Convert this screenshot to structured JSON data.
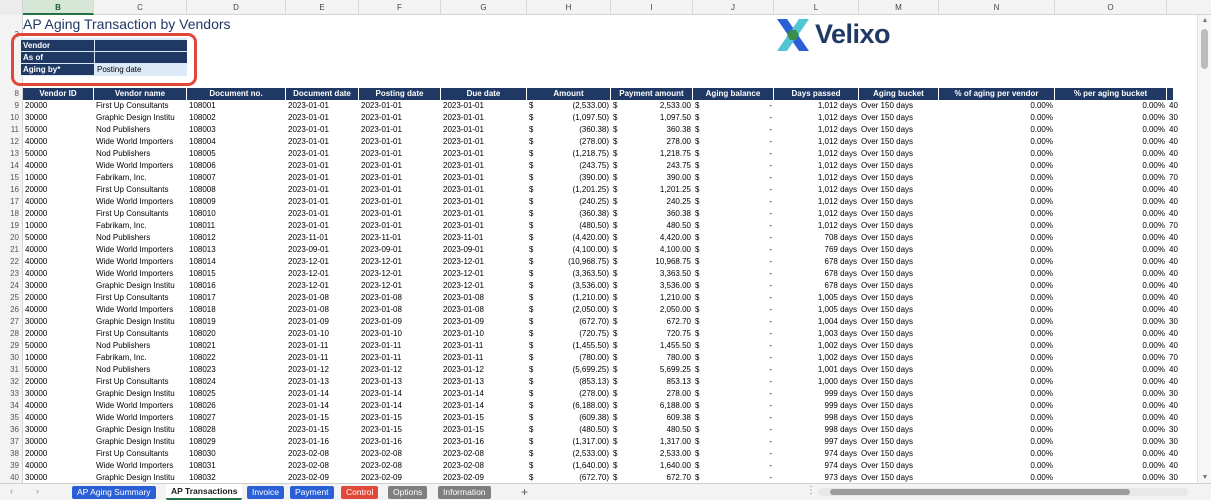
{
  "sheet": {
    "title": "AP Aging Transaction by Vendors",
    "column_letters": [
      "B",
      "C",
      "D",
      "E",
      "F",
      "G",
      "H",
      "I",
      "J",
      "L",
      "M",
      "N",
      "O"
    ],
    "selected_column": "B"
  },
  "params": {
    "vendor_label": "Vendor",
    "vendor_value": "",
    "asof_label": "As of",
    "asof_value": "",
    "agingby_label": "Aging by*",
    "agingby_value": "Posting date"
  },
  "logo": {
    "text": "Velixo",
    "icon": "velixo-x-logo-icon",
    "colors": [
      "#2b5fd6",
      "#3fbfd0",
      "#3b8d4a"
    ]
  },
  "table": {
    "headers": [
      "Vendor ID",
      "Vendor name",
      "Document no.",
      "Document date",
      "Posting date",
      "Due date",
      "Amount",
      "Payment amount",
      "Aging balance",
      "Days passed",
      "Aging bucket",
      "% of aging per vendor",
      "% per aging bucket"
    ],
    "rows": [
      {
        "rn": "9",
        "id": "20000",
        "name": "First Up Consultants",
        "doc": "108001",
        "ddate": "2023-01-01",
        "pdate": "2023-01-01",
        "due": "2023-01-01",
        "amt": "(2,533.00)",
        "pay": "2,533.00",
        "bal": "-",
        "days": "1,012 days",
        "bucket": "Over 150 days",
        "pv": "0.00%",
        "pb": "0.00%",
        "extra": "40"
      },
      {
        "rn": "10",
        "id": "30000",
        "name": "Graphic Design Institu",
        "doc": "108002",
        "ddate": "2023-01-01",
        "pdate": "2023-01-01",
        "due": "2023-01-01",
        "amt": "(1,097.50)",
        "pay": "1,097.50",
        "bal": "-",
        "days": "1,012 days",
        "bucket": "Over 150 days",
        "pv": "0.00%",
        "pb": "0.00%",
        "extra": "30"
      },
      {
        "rn": "11",
        "id": "50000",
        "name": "Nod Publishers",
        "doc": "108003",
        "ddate": "2023-01-01",
        "pdate": "2023-01-01",
        "due": "2023-01-01",
        "amt": "(360.38)",
        "pay": "360.38",
        "bal": "-",
        "days": "1,012 days",
        "bucket": "Over 150 days",
        "pv": "0.00%",
        "pb": "0.00%",
        "extra": "40"
      },
      {
        "rn": "12",
        "id": "40000",
        "name": "Wide World Importers",
        "doc": "108004",
        "ddate": "2023-01-01",
        "pdate": "2023-01-01",
        "due": "2023-01-01",
        "amt": "(278.00)",
        "pay": "278.00",
        "bal": "-",
        "days": "1,012 days",
        "bucket": "Over 150 days",
        "pv": "0.00%",
        "pb": "0.00%",
        "extra": "40"
      },
      {
        "rn": "13",
        "id": "50000",
        "name": "Nod Publishers",
        "doc": "108005",
        "ddate": "2023-01-01",
        "pdate": "2023-01-01",
        "due": "2023-01-01",
        "amt": "(1,218.75)",
        "pay": "1,218.75",
        "bal": "-",
        "days": "1,012 days",
        "bucket": "Over 150 days",
        "pv": "0.00%",
        "pb": "0.00%",
        "extra": "40"
      },
      {
        "rn": "14",
        "id": "40000",
        "name": "Wide World Importers",
        "doc": "108006",
        "ddate": "2023-01-01",
        "pdate": "2023-01-01",
        "due": "2023-01-01",
        "amt": "(243.75)",
        "pay": "243.75",
        "bal": "-",
        "days": "1,012 days",
        "bucket": "Over 150 days",
        "pv": "0.00%",
        "pb": "0.00%",
        "extra": "40"
      },
      {
        "rn": "15",
        "id": "10000",
        "name": "Fabrikam, Inc.",
        "doc": "108007",
        "ddate": "2023-01-01",
        "pdate": "2023-01-01",
        "due": "2023-01-01",
        "amt": "(390.00)",
        "pay": "390.00",
        "bal": "-",
        "days": "1,012 days",
        "bucket": "Over 150 days",
        "pv": "0.00%",
        "pb": "0.00%",
        "extra": "70"
      },
      {
        "rn": "16",
        "id": "20000",
        "name": "First Up Consultants",
        "doc": "108008",
        "ddate": "2023-01-01",
        "pdate": "2023-01-01",
        "due": "2023-01-01",
        "amt": "(1,201.25)",
        "pay": "1,201.25",
        "bal": "-",
        "days": "1,012 days",
        "bucket": "Over 150 days",
        "pv": "0.00%",
        "pb": "0.00%",
        "extra": "40"
      },
      {
        "rn": "17",
        "id": "40000",
        "name": "Wide World Importers",
        "doc": "108009",
        "ddate": "2023-01-01",
        "pdate": "2023-01-01",
        "due": "2023-01-01",
        "amt": "(240.25)",
        "pay": "240.25",
        "bal": "-",
        "days": "1,012 days",
        "bucket": "Over 150 days",
        "pv": "0.00%",
        "pb": "0.00%",
        "extra": "40"
      },
      {
        "rn": "18",
        "id": "20000",
        "name": "First Up Consultants",
        "doc": "108010",
        "ddate": "2023-01-01",
        "pdate": "2023-01-01",
        "due": "2023-01-01",
        "amt": "(360.38)",
        "pay": "360.38",
        "bal": "-",
        "days": "1,012 days",
        "bucket": "Over 150 days",
        "pv": "0.00%",
        "pb": "0.00%",
        "extra": "40"
      },
      {
        "rn": "19",
        "id": "10000",
        "name": "Fabrikam, Inc.",
        "doc": "108011",
        "ddate": "2023-01-01",
        "pdate": "2023-01-01",
        "due": "2023-01-01",
        "amt": "(480.50)",
        "pay": "480.50",
        "bal": "-",
        "days": "1,012 days",
        "bucket": "Over 150 days",
        "pv": "0.00%",
        "pb": "0.00%",
        "extra": "70"
      },
      {
        "rn": "20",
        "id": "50000",
        "name": "Nod Publishers",
        "doc": "108012",
        "ddate": "2023-11-01",
        "pdate": "2023-11-01",
        "due": "2023-11-01",
        "amt": "(4,420.00)",
        "pay": "4,420.00",
        "bal": "-",
        "days": "708 days",
        "bucket": "Over 150 days",
        "pv": "0.00%",
        "pb": "0.00%",
        "extra": "40"
      },
      {
        "rn": "21",
        "id": "40000",
        "name": "Wide World Importers",
        "doc": "108013",
        "ddate": "2023-09-01",
        "pdate": "2023-09-01",
        "due": "2023-09-01",
        "amt": "(4,100.00)",
        "pay": "4,100.00",
        "bal": "-",
        "days": "769 days",
        "bucket": "Over 150 days",
        "pv": "0.00%",
        "pb": "0.00%",
        "extra": "40"
      },
      {
        "rn": "22",
        "id": "40000",
        "name": "Wide World Importers",
        "doc": "108014",
        "ddate": "2023-12-01",
        "pdate": "2023-12-01",
        "due": "2023-12-01",
        "amt": "(10,968.75)",
        "pay": "10,968.75",
        "bal": "-",
        "days": "678 days",
        "bucket": "Over 150 days",
        "pv": "0.00%",
        "pb": "0.00%",
        "extra": "40"
      },
      {
        "rn": "23",
        "id": "40000",
        "name": "Wide World Importers",
        "doc": "108015",
        "ddate": "2023-12-01",
        "pdate": "2023-12-01",
        "due": "2023-12-01",
        "amt": "(3,363.50)",
        "pay": "3,363.50",
        "bal": "-",
        "days": "678 days",
        "bucket": "Over 150 days",
        "pv": "0.00%",
        "pb": "0.00%",
        "extra": "40"
      },
      {
        "rn": "24",
        "id": "30000",
        "name": "Graphic Design Institu",
        "doc": "108016",
        "ddate": "2023-12-01",
        "pdate": "2023-12-01",
        "due": "2023-12-01",
        "amt": "(3,536.00)",
        "pay": "3,536.00",
        "bal": "-",
        "days": "678 days",
        "bucket": "Over 150 days",
        "pv": "0.00%",
        "pb": "0.00%",
        "extra": "40"
      },
      {
        "rn": "25",
        "id": "20000",
        "name": "First Up Consultants",
        "doc": "108017",
        "ddate": "2023-01-08",
        "pdate": "2023-01-08",
        "due": "2023-01-08",
        "amt": "(1,210.00)",
        "pay": "1,210.00",
        "bal": "-",
        "days": "1,005 days",
        "bucket": "Over 150 days",
        "pv": "0.00%",
        "pb": "0.00%",
        "extra": "40"
      },
      {
        "rn": "26",
        "id": "40000",
        "name": "Wide World Importers",
        "doc": "108018",
        "ddate": "2023-01-08",
        "pdate": "2023-01-08",
        "due": "2023-01-08",
        "amt": "(2,050.00)",
        "pay": "2,050.00",
        "bal": "-",
        "days": "1,005 days",
        "bucket": "Over 150 days",
        "pv": "0.00%",
        "pb": "0.00%",
        "extra": "40"
      },
      {
        "rn": "27",
        "id": "30000",
        "name": "Graphic Design Institu",
        "doc": "108019",
        "ddate": "2023-01-09",
        "pdate": "2023-01-09",
        "due": "2023-01-09",
        "amt": "(672.70)",
        "pay": "672.70",
        "bal": "-",
        "days": "1,004 days",
        "bucket": "Over 150 days",
        "pv": "0.00%",
        "pb": "0.00%",
        "extra": "30"
      },
      {
        "rn": "28",
        "id": "20000",
        "name": "First Up Consultants",
        "doc": "108020",
        "ddate": "2023-01-10",
        "pdate": "2023-01-10",
        "due": "2023-01-10",
        "amt": "(720.75)",
        "pay": "720.75",
        "bal": "-",
        "days": "1,003 days",
        "bucket": "Over 150 days",
        "pv": "0.00%",
        "pb": "0.00%",
        "extra": "40"
      },
      {
        "rn": "29",
        "id": "50000",
        "name": "Nod Publishers",
        "doc": "108021",
        "ddate": "2023-01-11",
        "pdate": "2023-01-11",
        "due": "2023-01-11",
        "amt": "(1,455.50)",
        "pay": "1,455.50",
        "bal": "-",
        "days": "1,002 days",
        "bucket": "Over 150 days",
        "pv": "0.00%",
        "pb": "0.00%",
        "extra": "40"
      },
      {
        "rn": "30",
        "id": "10000",
        "name": "Fabrikam, Inc.",
        "doc": "108022",
        "ddate": "2023-01-11",
        "pdate": "2023-01-11",
        "due": "2023-01-11",
        "amt": "(780.00)",
        "pay": "780.00",
        "bal": "-",
        "days": "1,002 days",
        "bucket": "Over 150 days",
        "pv": "0.00%",
        "pb": "0.00%",
        "extra": "70"
      },
      {
        "rn": "31",
        "id": "50000",
        "name": "Nod Publishers",
        "doc": "108023",
        "ddate": "2023-01-12",
        "pdate": "2023-01-12",
        "due": "2023-01-12",
        "amt": "(5,699.25)",
        "pay": "5,699.25",
        "bal": "-",
        "days": "1,001 days",
        "bucket": "Over 150 days",
        "pv": "0.00%",
        "pb": "0.00%",
        "extra": "40"
      },
      {
        "rn": "32",
        "id": "20000",
        "name": "First Up Consultants",
        "doc": "108024",
        "ddate": "2023-01-13",
        "pdate": "2023-01-13",
        "due": "2023-01-13",
        "amt": "(853.13)",
        "pay": "853.13",
        "bal": "-",
        "days": "1,000 days",
        "bucket": "Over 150 days",
        "pv": "0.00%",
        "pb": "0.00%",
        "extra": "40"
      },
      {
        "rn": "33",
        "id": "30000",
        "name": "Graphic Design Institu",
        "doc": "108025",
        "ddate": "2023-01-14",
        "pdate": "2023-01-14",
        "due": "2023-01-14",
        "amt": "(278.00)",
        "pay": "278.00",
        "bal": "-",
        "days": "999 days",
        "bucket": "Over 150 days",
        "pv": "0.00%",
        "pb": "0.00%",
        "extra": "30"
      },
      {
        "rn": "34",
        "id": "40000",
        "name": "Wide World Importers",
        "doc": "108026",
        "ddate": "2023-01-14",
        "pdate": "2023-01-14",
        "due": "2023-01-14",
        "amt": "(6,188.00)",
        "pay": "6,188.00",
        "bal": "-",
        "days": "999 days",
        "bucket": "Over 150 days",
        "pv": "0.00%",
        "pb": "0.00%",
        "extra": "40"
      },
      {
        "rn": "35",
        "id": "40000",
        "name": "Wide World Importers",
        "doc": "108027",
        "ddate": "2023-01-15",
        "pdate": "2023-01-15",
        "due": "2023-01-15",
        "amt": "(609.38)",
        "pay": "609.38",
        "bal": "-",
        "days": "998 days",
        "bucket": "Over 150 days",
        "pv": "0.00%",
        "pb": "0.00%",
        "extra": "40"
      },
      {
        "rn": "36",
        "id": "30000",
        "name": "Graphic Design Institu",
        "doc": "108028",
        "ddate": "2023-01-15",
        "pdate": "2023-01-15",
        "due": "2023-01-15",
        "amt": "(480.50)",
        "pay": "480.50",
        "bal": "-",
        "days": "998 days",
        "bucket": "Over 150 days",
        "pv": "0.00%",
        "pb": "0.00%",
        "extra": "30"
      },
      {
        "rn": "37",
        "id": "30000",
        "name": "Graphic Design Institu",
        "doc": "108029",
        "ddate": "2023-01-16",
        "pdate": "2023-01-16",
        "due": "2023-01-16",
        "amt": "(1,317.00)",
        "pay": "1,317.00",
        "bal": "-",
        "days": "997 days",
        "bucket": "Over 150 days",
        "pv": "0.00%",
        "pb": "0.00%",
        "extra": "30"
      },
      {
        "rn": "38",
        "id": "20000",
        "name": "First Up Consultants",
        "doc": "108030",
        "ddate": "2023-02-08",
        "pdate": "2023-02-08",
        "due": "2023-02-08",
        "amt": "(2,533.00)",
        "pay": "2,533.00",
        "bal": "-",
        "days": "974 days",
        "bucket": "Over 150 days",
        "pv": "0.00%",
        "pb": "0.00%",
        "extra": "40"
      },
      {
        "rn": "39",
        "id": "40000",
        "name": "Wide World Importers",
        "doc": "108031",
        "ddate": "2023-02-08",
        "pdate": "2023-02-08",
        "due": "2023-02-08",
        "amt": "(1,640.00)",
        "pay": "1,640.00",
        "bal": "-",
        "days": "974 days",
        "bucket": "Over 150 days",
        "pv": "0.00%",
        "pb": "0.00%",
        "extra": "40"
      },
      {
        "rn": "40",
        "id": "30000",
        "name": "Graphic Design Institu",
        "doc": "108032",
        "ddate": "2023-02-09",
        "pdate": "2023-02-09",
        "due": "2023-02-09",
        "amt": "(672.70)",
        "pay": "672.70",
        "bal": "-",
        "days": "973 days",
        "bucket": "Over 150 days",
        "pv": "0.00%",
        "pb": "0.00%",
        "extra": "30"
      }
    ]
  },
  "tabs": [
    {
      "label": "AP Aging Summary",
      "color": "#2b5fd6",
      "active": false
    },
    {
      "label": "AP Transactions",
      "color": "#ffffff",
      "active": true
    },
    {
      "label": "Invoice",
      "color": "#2b5fd6",
      "active": false
    },
    {
      "label": "Payment",
      "color": "#2b5fd6",
      "active": false
    },
    {
      "label": "Control",
      "color": "#e0483a",
      "active": false
    },
    {
      "label": "Options",
      "color": "#7f7f7f",
      "active": false
    },
    {
      "label": "Information",
      "color": "#7f7f7f",
      "active": false
    }
  ],
  "row_labels_top": [
    "3",
    "8"
  ],
  "colors": {
    "header_bg": "#1f3864",
    "param_bg": "#dce9f7",
    "highlight": "#e0483a"
  }
}
